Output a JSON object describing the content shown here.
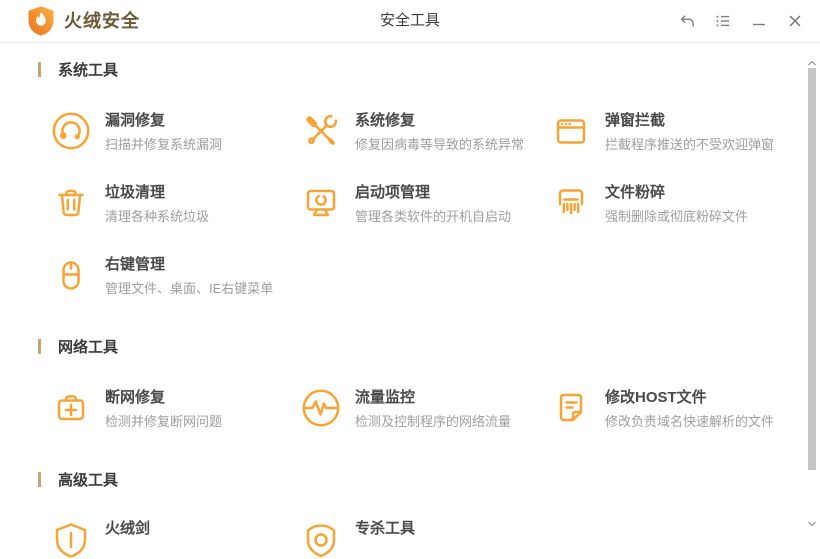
{
  "colors": {
    "accent": "#F7A434",
    "brand_text": "#6B5A38",
    "section_bar": "#C4A475",
    "header_text": "#3B3B3B",
    "item_title": "#4A4A4A",
    "item_desc": "#9E9E9E",
    "control_gray": "#7D7D7D",
    "scrollbar_thumb": "#C6C6C6"
  },
  "titlebar": {
    "brand": "火绒安全",
    "title": "安全工具",
    "logo_icon": "flame-shield-logo",
    "controls": [
      {
        "icon": "back-arrow-icon"
      },
      {
        "icon": "task-list-icon"
      },
      {
        "icon": "minimize-icon"
      },
      {
        "icon": "close-icon"
      }
    ]
  },
  "sections": [
    {
      "label": "系统工具",
      "items": [
        {
          "icon": "vulnerability-fix-icon",
          "title": "漏洞修复",
          "desc": "扫描并修复系统漏洞"
        },
        {
          "icon": "system-repair-icon",
          "title": "系统修复",
          "desc": "修复因病毒等导致的系统异常"
        },
        {
          "icon": "popup-blocker-icon",
          "title": "弹窗拦截",
          "desc": "拦截程序推送的不受欢迎弹窗"
        },
        {
          "icon": "junk-cleaner-icon",
          "title": "垃圾清理",
          "desc": "清理各种系统垃圾"
        },
        {
          "icon": "startup-manager-icon",
          "title": "启动项管理",
          "desc": "管理各类软件的开机自启动"
        },
        {
          "icon": "file-shredder-icon",
          "title": "文件粉碎",
          "desc": "强制删除或彻底粉碎文件"
        },
        {
          "icon": "context-menu-manager-icon",
          "title": "右键管理",
          "desc": "管理文件、桌面、IE右键菜单"
        }
      ]
    },
    {
      "label": "网络工具",
      "items": [
        {
          "icon": "network-repair-icon",
          "title": "断网修复",
          "desc": "检测并修复断网问题"
        },
        {
          "icon": "traffic-monitor-icon",
          "title": "流量监控",
          "desc": "检测及控制程序的网络流量"
        },
        {
          "icon": "host-file-icon",
          "title": "修改HOST文件",
          "desc": "修改负责域名快速解析的文件"
        }
      ]
    },
    {
      "label": "高级工具",
      "items": [
        {
          "icon": "huorong-sword-icon",
          "title": "火绒剑"
        },
        {
          "icon": "special-kill-tool-icon",
          "title": "专杀工具"
        }
      ]
    }
  ]
}
